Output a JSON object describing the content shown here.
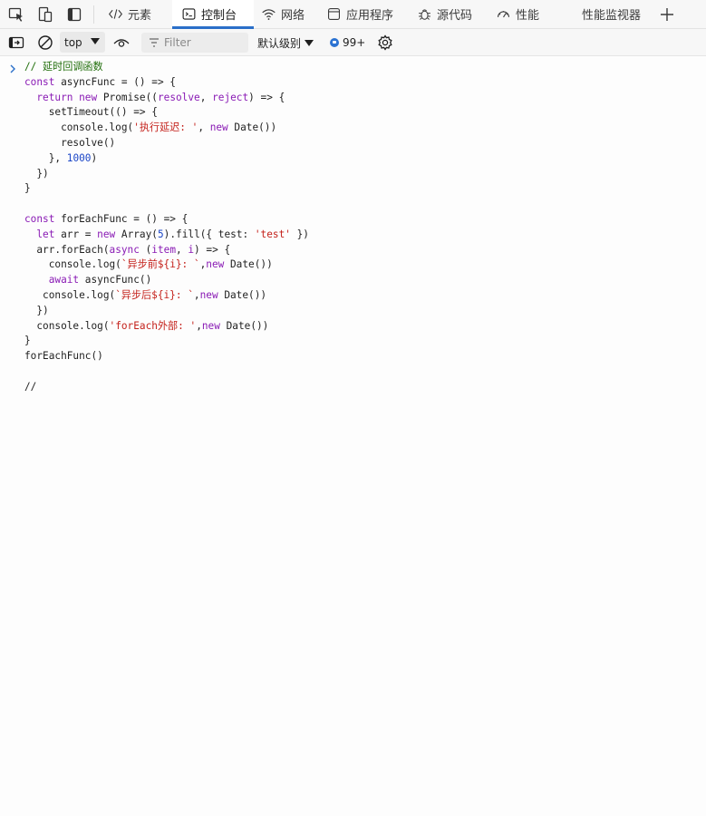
{
  "tabs": [
    {
      "label": "元素",
      "icon": "code-brackets-icon",
      "active": false
    },
    {
      "label": "控制台",
      "icon": "console-icon",
      "active": true
    },
    {
      "label": "网络",
      "icon": "wifi-icon",
      "active": false
    },
    {
      "label": "应用程序",
      "icon": "application-icon",
      "active": false
    },
    {
      "label": "源代码",
      "icon": "bug-icon",
      "active": false
    },
    {
      "label": "性能",
      "icon": "speedometer-icon",
      "active": false
    },
    {
      "label": "性能监视器",
      "icon": "",
      "active": false
    }
  ],
  "toolbar": {
    "context": "top",
    "filter_placeholder": "Filter",
    "level": "默认级别",
    "issues_count": "99+"
  },
  "colors": {
    "accent": "#2a6fc9",
    "keyword": "#8a1bb5",
    "string": "#c4211b",
    "number": "#1b46c7",
    "comment": "#216e0b"
  },
  "console": {
    "code_lines": [
      [
        {
          "t": "cmt",
          "v": "// 延时回调函数"
        }
      ],
      [
        {
          "t": "kw",
          "v": "const"
        },
        {
          "t": "pl",
          "v": " asyncFunc = () => {"
        }
      ],
      [
        {
          "t": "pl",
          "v": "  "
        },
        {
          "t": "kw",
          "v": "return"
        },
        {
          "t": "pl",
          "v": " "
        },
        {
          "t": "kw",
          "v": "new"
        },
        {
          "t": "pl",
          "v": " Promise(("
        },
        {
          "t": "kw",
          "v": "resolve"
        },
        {
          "t": "pl",
          "v": ", "
        },
        {
          "t": "kw",
          "v": "reject"
        },
        {
          "t": "pl",
          "v": ") => {"
        }
      ],
      [
        {
          "t": "pl",
          "v": "    setTimeout(() => {"
        }
      ],
      [
        {
          "t": "pl",
          "v": "      console.log("
        },
        {
          "t": "str",
          "v": "'执行延迟: '"
        },
        {
          "t": "pl",
          "v": ", "
        },
        {
          "t": "kw",
          "v": "new"
        },
        {
          "t": "pl",
          "v": " Date())"
        }
      ],
      [
        {
          "t": "pl",
          "v": "      resolve()"
        }
      ],
      [
        {
          "t": "pl",
          "v": "    }, "
        },
        {
          "t": "num",
          "v": "1000"
        },
        {
          "t": "pl",
          "v": ")"
        }
      ],
      [
        {
          "t": "pl",
          "v": "  })"
        }
      ],
      [
        {
          "t": "pl",
          "v": "}"
        }
      ],
      [],
      [
        {
          "t": "kw",
          "v": "const"
        },
        {
          "t": "pl",
          "v": " forEachFunc = () => {"
        }
      ],
      [
        {
          "t": "pl",
          "v": "  "
        },
        {
          "t": "kw",
          "v": "let"
        },
        {
          "t": "pl",
          "v": " arr = "
        },
        {
          "t": "kw",
          "v": "new"
        },
        {
          "t": "pl",
          "v": " Array("
        },
        {
          "t": "num",
          "v": "5"
        },
        {
          "t": "pl",
          "v": ").fill({ test: "
        },
        {
          "t": "str",
          "v": "'test'"
        },
        {
          "t": "pl",
          "v": " })"
        }
      ],
      [
        {
          "t": "pl",
          "v": "  arr.forEach("
        },
        {
          "t": "kw",
          "v": "async"
        },
        {
          "t": "pl",
          "v": " ("
        },
        {
          "t": "kw",
          "v": "item"
        },
        {
          "t": "pl",
          "v": ", "
        },
        {
          "t": "kw",
          "v": "i"
        },
        {
          "t": "pl",
          "v": ") => {"
        }
      ],
      [
        {
          "t": "pl",
          "v": "    console.log("
        },
        {
          "t": "str",
          "v": "`异步前${i}: `"
        },
        {
          "t": "pl",
          "v": ","
        },
        {
          "t": "kw",
          "v": "new"
        },
        {
          "t": "pl",
          "v": " Date())"
        }
      ],
      [
        {
          "t": "pl",
          "v": "    "
        },
        {
          "t": "kw",
          "v": "await"
        },
        {
          "t": "pl",
          "v": " asyncFunc()"
        }
      ],
      [
        {
          "t": "pl",
          "v": "   console.log("
        },
        {
          "t": "str",
          "v": "`异步后${i}: `"
        },
        {
          "t": "pl",
          "v": ","
        },
        {
          "t": "kw",
          "v": "new"
        },
        {
          "t": "pl",
          "v": " Date())"
        }
      ],
      [
        {
          "t": "pl",
          "v": "  })"
        }
      ],
      [
        {
          "t": "pl",
          "v": "  console.log("
        },
        {
          "t": "str",
          "v": "'forEach外部: '"
        },
        {
          "t": "pl",
          "v": ","
        },
        {
          "t": "kw",
          "v": "new"
        },
        {
          "t": "pl",
          "v": " Date())"
        }
      ],
      [
        {
          "t": "pl",
          "v": "}"
        }
      ],
      [
        {
          "t": "pl",
          "v": "forEachFunc()"
        }
      ],
      [],
      [
        {
          "t": "pl",
          "v": "//"
        }
      ]
    ]
  }
}
